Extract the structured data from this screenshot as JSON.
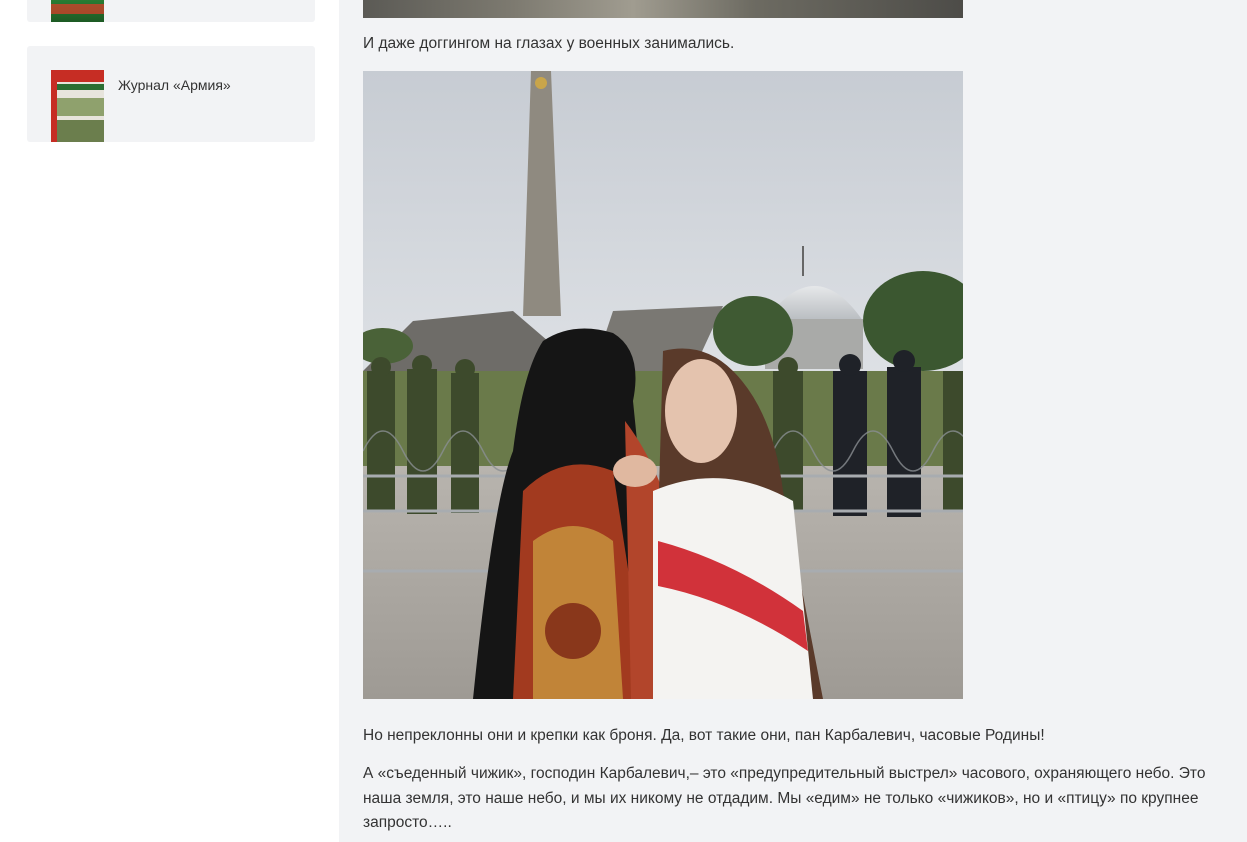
{
  "sidebar": {
    "items": [
      {
        "label": ""
      },
      {
        "label": "Журнал «Армия»"
      }
    ]
  },
  "article": {
    "caption": "И даже доггингом на глазах у военных занимались.",
    "paragraph1": "Но непреклонны они и крепки как броня. Да, вот такие они, пан Карбалевич, часовые Родины!",
    "paragraph2": "А «съеденный чижик», господин Карбалевич,– это «предупредительный выстрел» часового, охраняющего небо. Это наша земля, это наше небо, и мы их никому не отдадим. Мы «едим» не только «чижиков», но и «птицу» по крупнее запросто…..",
    "image_description_alt": ""
  },
  "colors": {
    "page_bg": "#f2f3f5",
    "card_bg": "#f2f3f5",
    "text": "#333333"
  }
}
